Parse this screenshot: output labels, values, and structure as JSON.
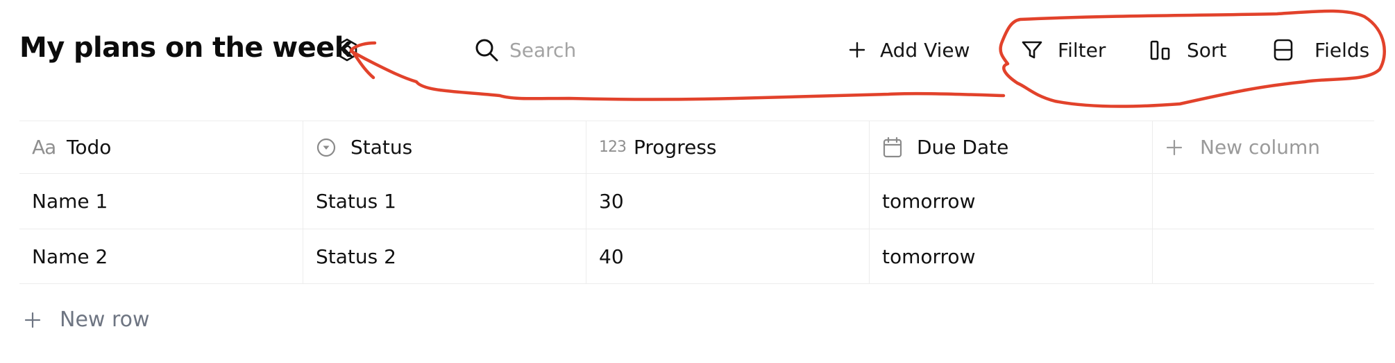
{
  "header": {
    "title": "My plans on the week",
    "settings_icon": "hexagon-nut-icon",
    "search": {
      "placeholder": "Search",
      "value": ""
    },
    "add_view_label": "Add View",
    "filter_label": "Filter",
    "sort_label": "Sort",
    "fields_label": "Fields"
  },
  "table": {
    "columns": [
      {
        "label": "Todo",
        "icon": "Aa"
      },
      {
        "label": "Status",
        "icon": "status-dropdown-icon"
      },
      {
        "label": "Progress",
        "icon": "123"
      },
      {
        "label": "Due Date",
        "icon": "calendar-icon"
      }
    ],
    "new_column_label": "New column",
    "rows": [
      {
        "todo": "Name 1",
        "status": "Status 1",
        "progress": "30",
        "due_date": "tomorrow"
      },
      {
        "todo": "Name 2",
        "status": "Status 2",
        "progress": "40",
        "due_date": "tomorrow"
      }
    ],
    "new_row_label": "New row"
  },
  "colors": {
    "annotation": "#e2422b",
    "placeholder": "#a3a3a3",
    "muted": "#6e7582",
    "border": "#ececec"
  }
}
